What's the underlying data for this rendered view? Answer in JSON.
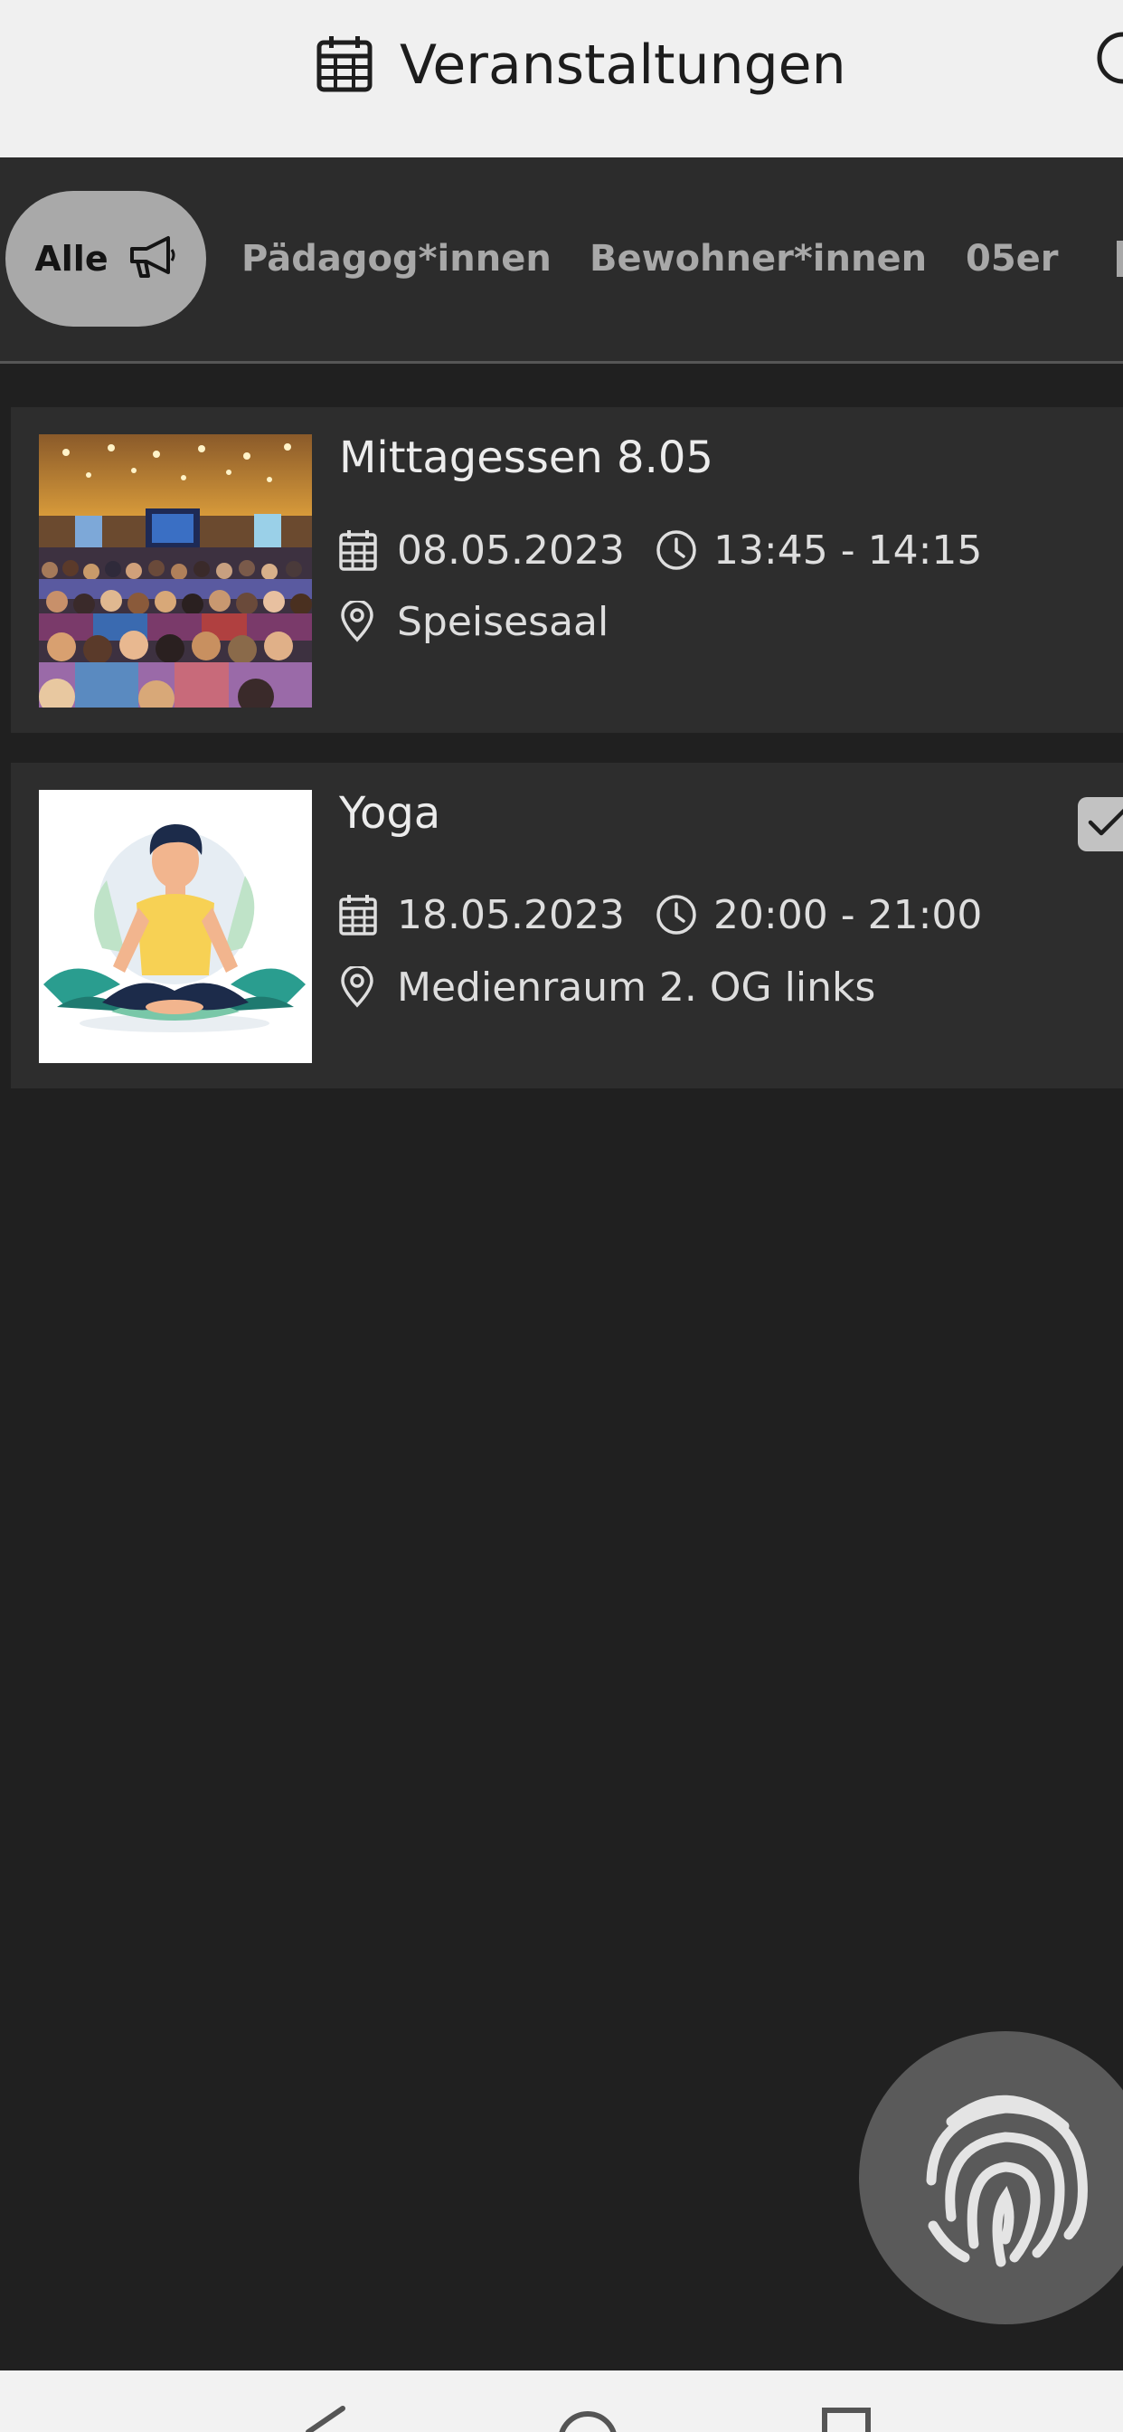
{
  "header": {
    "title": "Veranstaltungen",
    "icon": "calendar-icon",
    "search_icon": "search-icon"
  },
  "filters": {
    "active": "Alle",
    "items": [
      {
        "label": "Alle",
        "icon": "megaphone-icon",
        "selected": true
      },
      {
        "label": "Pädagog*innen",
        "selected": false
      },
      {
        "label": "Bewohner*innen",
        "selected": false
      },
      {
        "label": "05er",
        "selected": false
      }
    ]
  },
  "events": [
    {
      "title": "Mittagessen 8.05",
      "date": "08.05.2023",
      "time": "13:45 - 14:15",
      "location": "Speisesaal",
      "image": "conference-audience-photo",
      "checked": false
    },
    {
      "title": "Yoga",
      "date": "18.05.2023",
      "time": "20:00 - 21:00",
      "location": "Medienraum 2. OG links",
      "image": "meditating-person-illustration",
      "checked": true
    }
  ],
  "fab": {
    "icon": "fingerprint-icon"
  },
  "navbar": {
    "icons": [
      "back-icon",
      "home-icon",
      "recents-icon"
    ]
  },
  "colors": {
    "header_bg": "#f0f0f0",
    "page_bg": "#202020",
    "filter_bg": "#2c2c2c",
    "chip_active_bg": "#a9a9a9",
    "card_bg": "#2d2d2d",
    "fab_bg": "#5a5a5a"
  }
}
